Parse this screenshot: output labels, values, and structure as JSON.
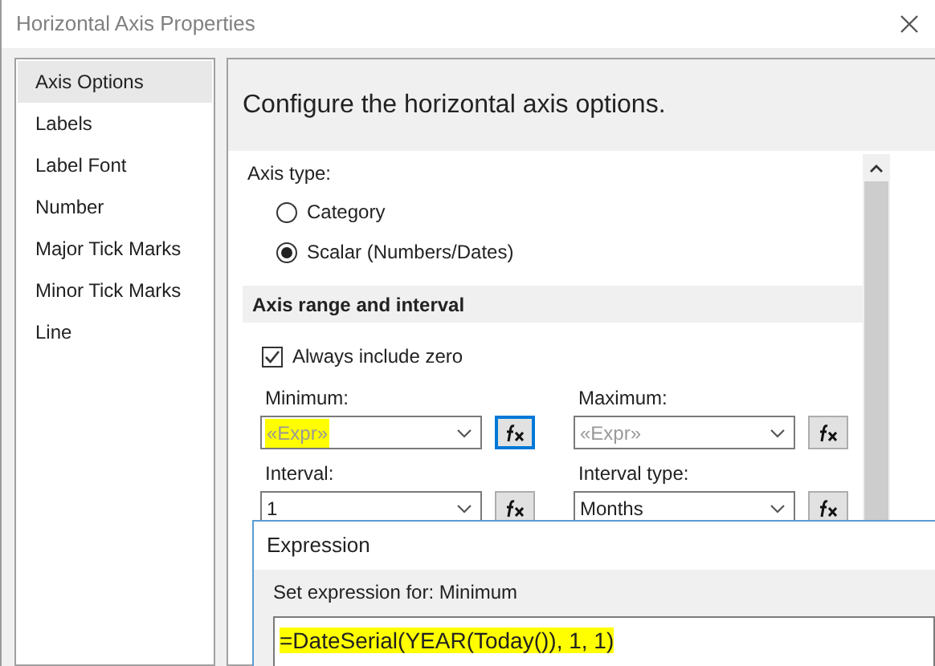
{
  "window": {
    "title": "Horizontal Axis Properties"
  },
  "sidebar": {
    "items": [
      {
        "label": "Axis Options",
        "selected": true
      },
      {
        "label": "Labels",
        "selected": false
      },
      {
        "label": "Label Font",
        "selected": false
      },
      {
        "label": "Number",
        "selected": false
      },
      {
        "label": "Major Tick Marks",
        "selected": false
      },
      {
        "label": "Minor Tick Marks",
        "selected": false
      },
      {
        "label": "Line",
        "selected": false
      }
    ]
  },
  "header": "Configure the horizontal axis options.",
  "axis_type": {
    "label": "Axis type:",
    "options": [
      {
        "label": "Category",
        "selected": false
      },
      {
        "label": "Scalar (Numbers/Dates)",
        "selected": true
      }
    ]
  },
  "section": {
    "title": "Axis range and interval",
    "always_include_zero": {
      "label": "Always include zero",
      "checked": true
    },
    "fields": [
      {
        "label": "Minimum:",
        "value": "«Expr»",
        "dimmed": true,
        "highlighted": true,
        "focused": true
      },
      {
        "label": "Maximum:",
        "value": "«Expr»",
        "dimmed": true,
        "highlighted": false,
        "focused": false
      },
      {
        "label": "Interval:",
        "value": "1",
        "dimmed": false,
        "highlighted": false,
        "focused": false
      },
      {
        "label": "Interval type:",
        "value": "Months",
        "dimmed": false,
        "highlighted": false,
        "focused": false
      }
    ]
  },
  "expression_dialog": {
    "title": "Expression",
    "prompt": "Set expression for: Minimum",
    "expression": "=DateSerial(YEAR(Today()), 1, 1)",
    "highlighted": true
  }
}
